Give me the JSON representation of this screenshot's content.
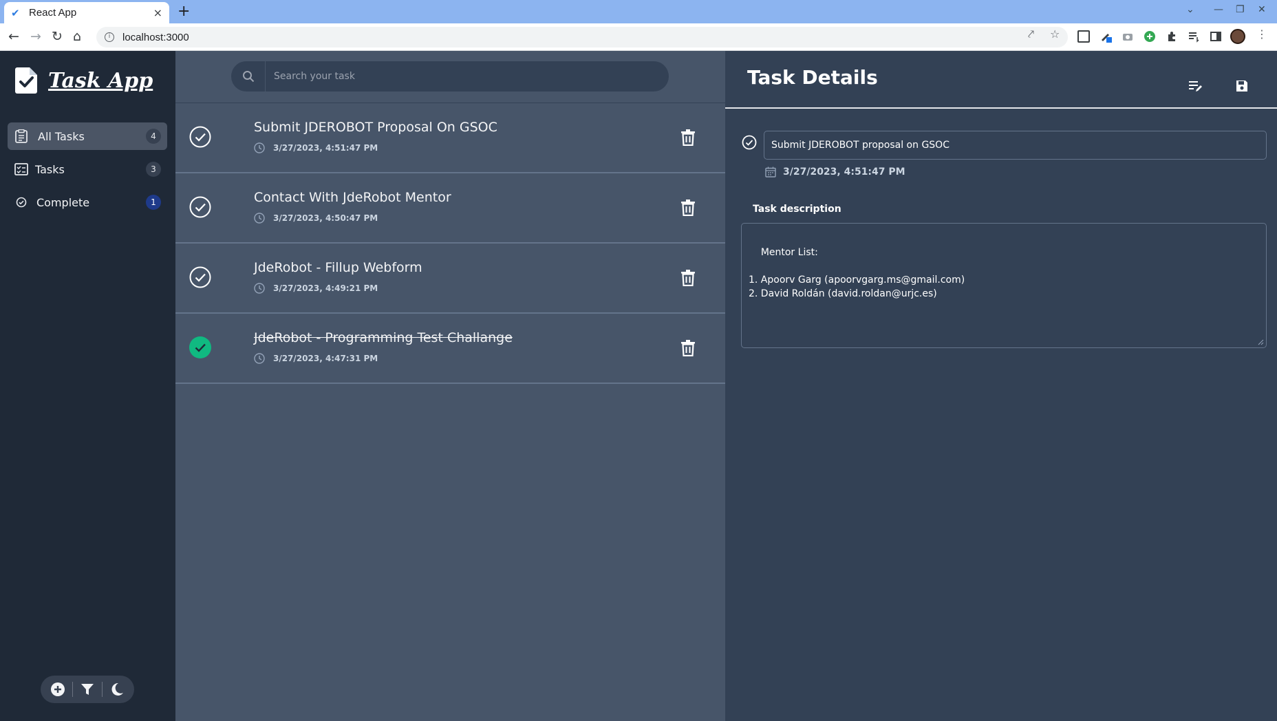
{
  "browser": {
    "tab_title": "React App",
    "tab_close": "×",
    "new_tab": "+",
    "url": "localhost:3000"
  },
  "sidebar": {
    "app_name": "Task App",
    "items": [
      {
        "label": "All Tasks",
        "count": "4",
        "icon": "clipboard-list-icon",
        "active": true
      },
      {
        "label": "Tasks",
        "count": "3",
        "icon": "checklist-icon",
        "active": false
      },
      {
        "label": "Complete",
        "count": "1",
        "icon": "check-circle-icon",
        "active": false
      }
    ],
    "tools": [
      "add-circle-icon",
      "filter-icon",
      "moon-icon"
    ]
  },
  "search": {
    "placeholder": "Search your task"
  },
  "tasks": [
    {
      "title": "Submit JDEROBOT Proposal On GSOC",
      "date": "3/27/2023, 4:51:47 PM",
      "completed": false
    },
    {
      "title": "Contact With JdeRobot Mentor",
      "date": "3/27/2023, 4:50:47 PM",
      "completed": false
    },
    {
      "title": "JdeRobot - Fillup Webform",
      "date": "3/27/2023, 4:49:21 PM",
      "completed": false
    },
    {
      "title": "JdeRobot - Programming Test Challange",
      "date": "3/27/2023, 4:47:31 PM",
      "completed": true
    }
  ],
  "details": {
    "heading": "Task Details",
    "title_value": "Submit JDEROBOT proposal on GSOC",
    "date": "3/27/2023, 4:51:47 PM",
    "description_label": "Task description",
    "description_value": "Mentor List:\n\n1. Apoorv Garg (apoorvgarg.ms@gmail.com)\n2. David Roldán (david.roldan@urjc.es)"
  },
  "colors": {
    "sidebar_bg": "#1f2937",
    "list_bg": "#475569",
    "details_bg": "#334155",
    "complete_green": "#10b981",
    "badge_blue": "#1e3a8a"
  }
}
